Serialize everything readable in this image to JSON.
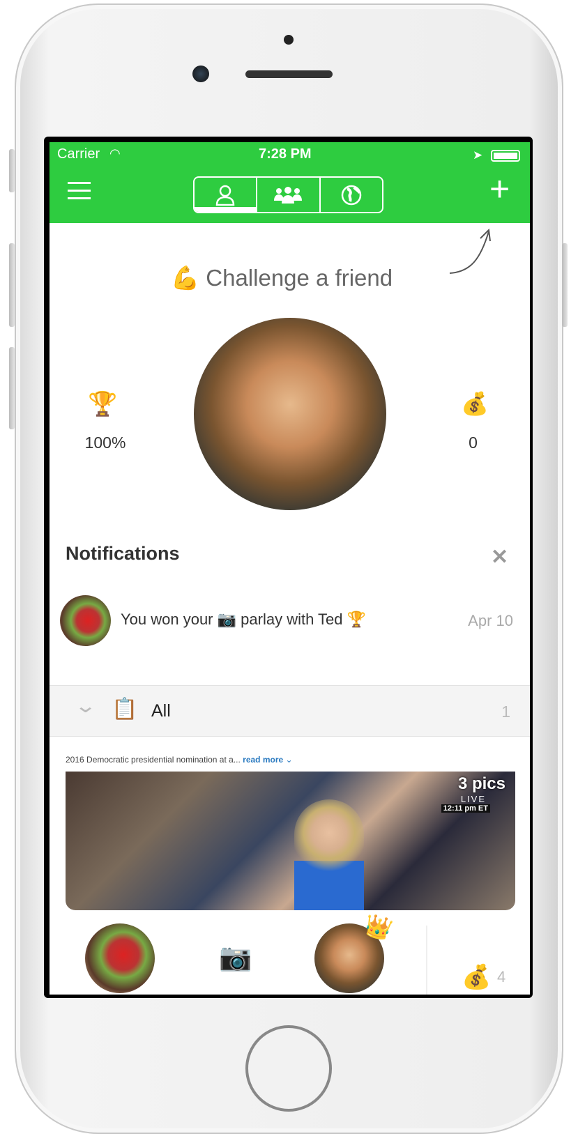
{
  "status_bar": {
    "carrier": "Carrier",
    "time": "7:28 PM"
  },
  "nav": {
    "tabs": [
      {
        "icon": "person-icon",
        "active": true
      },
      {
        "icon": "group-icon",
        "active": false
      },
      {
        "icon": "globe-icon",
        "active": false
      }
    ],
    "menu_icon": "hamburger-icon",
    "add_icon": "plus-icon"
  },
  "colors": {
    "brand_green": "#2ecc40"
  },
  "profile": {
    "challenge_emoji": "💪",
    "challenge_label": "Challenge a friend",
    "win_rate_emoji": "🏆",
    "win_rate": "100%",
    "money_emoji": "💰",
    "money": "0"
  },
  "notifications": {
    "title": "Notifications",
    "items": [
      {
        "text_before": "You won your",
        "emoji_mid": "📷",
        "text_after": "parlay with Ted",
        "emoji_end": "🏆",
        "date": "Apr 10"
      }
    ]
  },
  "feed": {
    "section_emoji": "📋",
    "section_label": "All",
    "section_count": "1",
    "card": {
      "caption": "2016 Democratic presidential nomination at a...",
      "read_more": "read more",
      "pics_label": "3 pics",
      "live_label": "LIVE",
      "live_time": "12:11 pm ET",
      "middle_emoji": "📷",
      "crown_emoji": "👑",
      "money_emoji": "💰",
      "money": "4"
    }
  }
}
